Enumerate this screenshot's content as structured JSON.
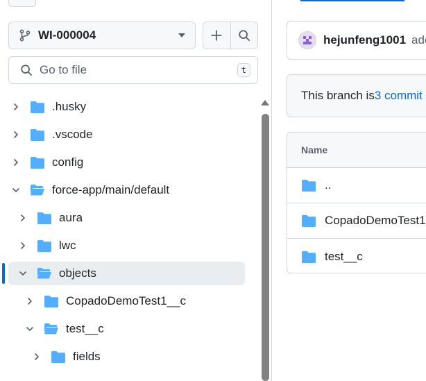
{
  "sidebar": {
    "branch": {
      "label": "WI-000004"
    },
    "search": {
      "placeholder": "Go to file",
      "shortcut": "t"
    },
    "tree": [
      {
        "label": ".husky",
        "indent": 0,
        "expanded": false,
        "selected": false
      },
      {
        "label": ".vscode",
        "indent": 0,
        "expanded": false,
        "selected": false
      },
      {
        "label": "config",
        "indent": 0,
        "expanded": false,
        "selected": false
      },
      {
        "label": "force-app/main/default",
        "indent": 0,
        "expanded": true,
        "selected": false
      },
      {
        "label": "aura",
        "indent": 1,
        "expanded": false,
        "selected": false
      },
      {
        "label": "lwc",
        "indent": 1,
        "expanded": false,
        "selected": false
      },
      {
        "label": "objects",
        "indent": 1,
        "expanded": true,
        "selected": true
      },
      {
        "label": "CopadoDemoTest1__c",
        "indent": 2,
        "expanded": false,
        "selected": false
      },
      {
        "label": "test__c",
        "indent": 2,
        "expanded": true,
        "selected": false
      },
      {
        "label": "fields",
        "indent": 3,
        "expanded": false,
        "selected": false
      }
    ]
  },
  "main": {
    "commit": {
      "user": "hejunfeng1001",
      "message_fragment": "ado"
    },
    "branch_info": {
      "prefix": "This branch is ",
      "link": "3 commit"
    },
    "files": {
      "header": "Name",
      "rows": [
        {
          "name": ".."
        },
        {
          "name": "CopadoDemoTest1"
        },
        {
          "name": "test__c"
        }
      ]
    }
  },
  "colors": {
    "folder": "#54aeff",
    "link": "#0969da",
    "selected_bar": "#0969da",
    "border": "#d0d7de"
  }
}
